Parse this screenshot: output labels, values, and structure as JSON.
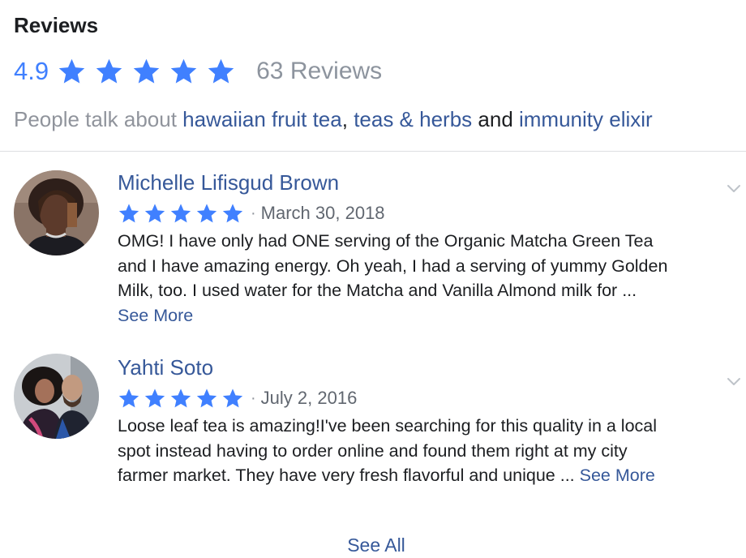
{
  "header": {
    "title": "Reviews",
    "rating": "4.9",
    "stars": 5,
    "review_count": "63 Reviews",
    "star_color": "#4080ff"
  },
  "topics": {
    "prefix": "People talk about ",
    "items": [
      "hawaiian fruit tea",
      "teas & herbs",
      "immunity elixir"
    ],
    "separator_1": ",",
    "separator_2": " and "
  },
  "reviews": [
    {
      "name": "Michelle Lifisgud Brown",
      "stars": 5,
      "dot": "·",
      "date": "March 30, 2018",
      "lines": [
        "OMG! I have only had ONE serving of the Organic Matcha Green Tea",
        "and I have amazing energy. Oh yeah, I had a serving of yummy Golden",
        "Milk, too. I used water for the Matcha and Vanilla Almond milk for ..."
      ],
      "see_more": "See More",
      "avatar_icon": "profile-photo"
    },
    {
      "name": "Yahti Soto",
      "stars": 5,
      "dot": "·",
      "date": "July 2, 2016",
      "lines": [
        "Loose leaf tea is amazing!I've been searching for this quality in a local",
        "spot instead having to order online and found them right at my city",
        "farmer market. They have very fresh flavorful and unique ..."
      ],
      "see_more": "See More",
      "avatar_icon": "profile-photo"
    }
  ],
  "footer": {
    "see_all": "See All"
  },
  "colors": {
    "link": "#365899",
    "accent": "#4080ff",
    "muted": "#90949c",
    "text": "#1c1e21"
  }
}
